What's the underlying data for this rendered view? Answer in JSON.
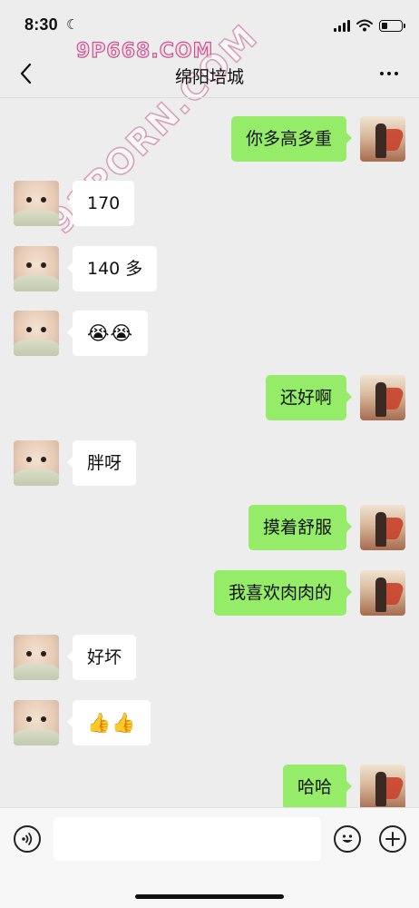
{
  "status_bar": {
    "time": "8:30",
    "moon_icon": "moon-icon",
    "signal_icon": "cellular-signal-icon",
    "wifi_icon": "wifi-icon",
    "battery_icon": "battery-icon",
    "battery_level": 0.3
  },
  "watermarks": {
    "top": "9P668.COM",
    "diagonal": "91PORN.COM"
  },
  "header": {
    "back_icon": "chevron-left-icon",
    "title": "绵阳培城",
    "more_icon": "more-dots-icon"
  },
  "messages": [
    {
      "from": "me",
      "text": "你多高多重"
    },
    {
      "from": "other",
      "text": "170"
    },
    {
      "from": "other",
      "text": "140 多"
    },
    {
      "from": "other",
      "text": "😭😭"
    },
    {
      "from": "me",
      "text": "还好啊"
    },
    {
      "from": "other",
      "text": "胖呀"
    },
    {
      "from": "me",
      "text": "摸着舒服"
    },
    {
      "from": "me",
      "text": "我喜欢肉肉的"
    },
    {
      "from": "other",
      "text": "好坏"
    },
    {
      "from": "other",
      "text": "👍👍"
    },
    {
      "from": "me",
      "text": "哈哈"
    }
  ],
  "input_bar": {
    "voice_icon": "voice-input-icon",
    "text_value": "",
    "emoji_icon": "emoji-icon",
    "plus_icon": "plus-circle-icon"
  },
  "colors": {
    "background": "#ededed",
    "outgoing_bubble": "#95ec69",
    "incoming_bubble": "#ffffff",
    "input_bar": "#f7f7f7"
  }
}
